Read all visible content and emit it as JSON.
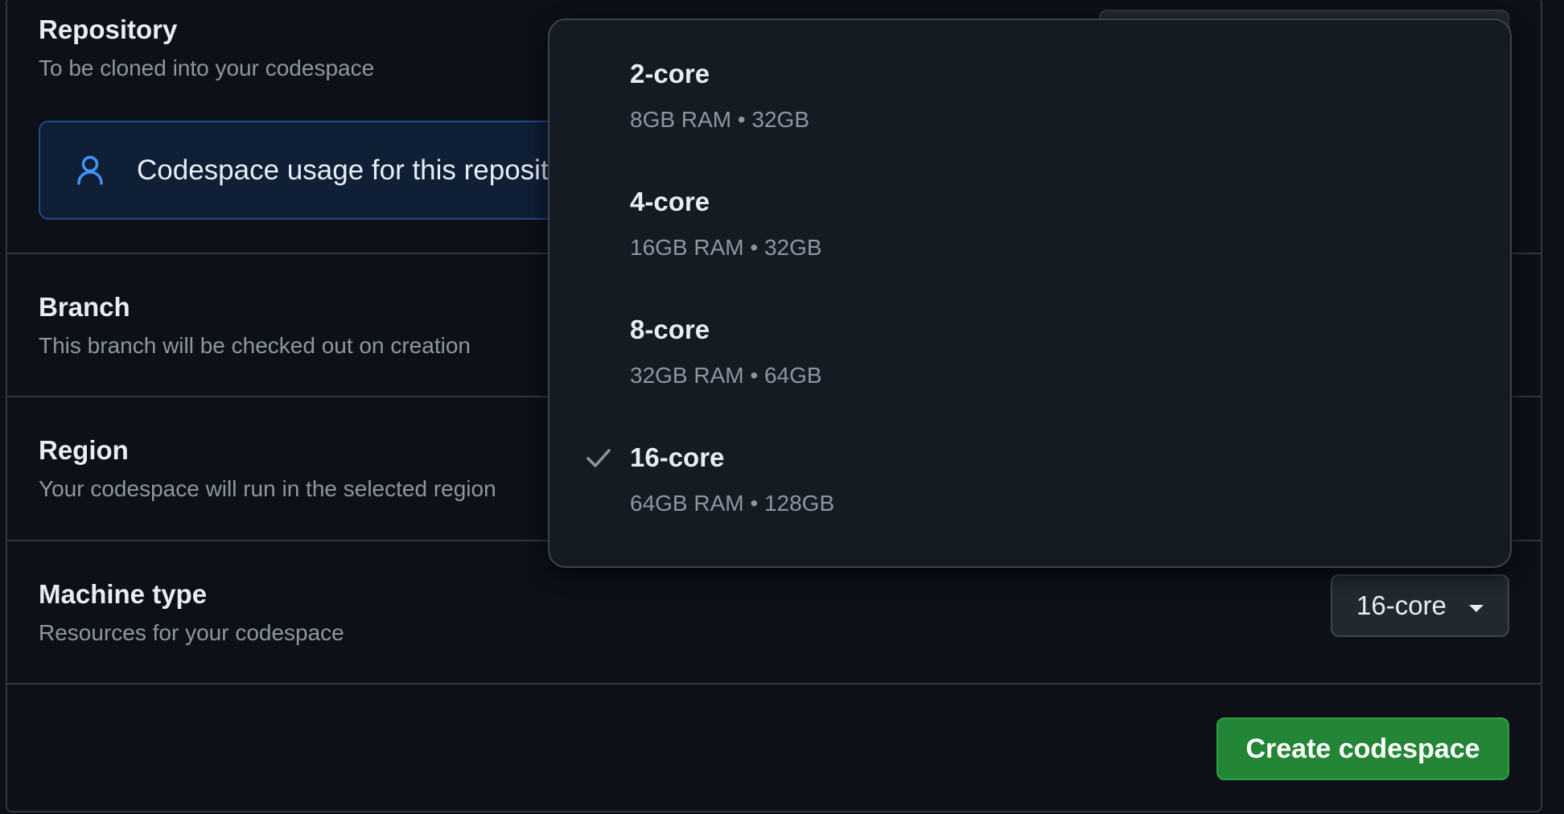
{
  "colors": {
    "background": "#0d1117",
    "border": "#30363d",
    "text_primary": "#e6edf3",
    "text_muted": "#8d96a0",
    "accent_blue": "#4493f8",
    "button_green": "#238636",
    "dropdown_bg": "#151b23"
  },
  "repository": {
    "title": "Repository",
    "description": "To be cloned into your codespace",
    "notice_text": "Codespace usage for this repository is paid for by",
    "notice_icon": "person-icon"
  },
  "branch": {
    "title": "Branch",
    "description": "This branch will be checked out on creation"
  },
  "region": {
    "title": "Region",
    "description": "Your codespace will run in the selected region"
  },
  "machine_type": {
    "title": "Machine type",
    "description": "Resources for your codespace",
    "selected_value": "16-core",
    "caret_icon": "triangle-down-icon"
  },
  "dropdown": {
    "options": [
      {
        "name": "2-core",
        "spec": "8GB RAM • 32GB",
        "selected": false
      },
      {
        "name": "4-core",
        "spec": "16GB RAM • 32GB",
        "selected": false
      },
      {
        "name": "8-core",
        "spec": "32GB RAM • 64GB",
        "selected": false
      },
      {
        "name": "16-core",
        "spec": "64GB RAM • 128GB",
        "selected": true
      }
    ],
    "check_icon": "check-icon"
  },
  "actions": {
    "create_label": "Create codespace"
  }
}
